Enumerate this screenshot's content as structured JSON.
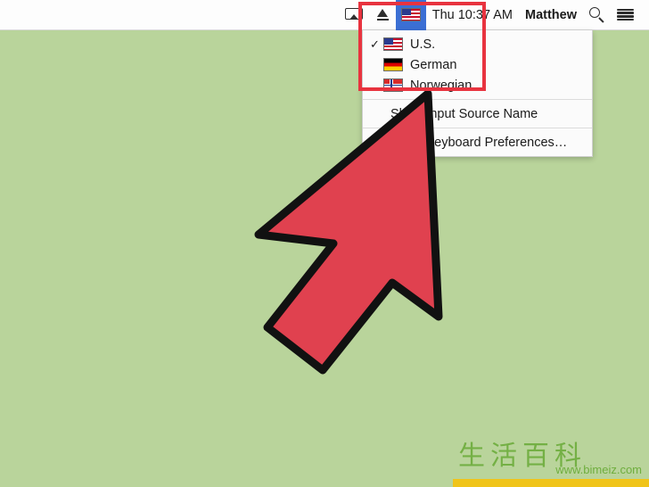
{
  "menubar": {
    "items": [
      {
        "name": "airplay-icon",
        "label": ""
      },
      {
        "name": "eject-icon",
        "label": ""
      },
      {
        "name": "input-source-flag",
        "label": ""
      }
    ],
    "clock": "Thu 10:37 AM",
    "user": "Matthew",
    "search_icon": "search-icon",
    "notification_icon": "list-icon"
  },
  "dropdown": {
    "sources": [
      {
        "label": "U.S.",
        "flag": "us",
        "checked": true,
        "check_glyph": "✓"
      },
      {
        "label": "German",
        "flag": "de",
        "checked": false,
        "check_glyph": ""
      },
      {
        "label": "Norwegian",
        "flag": "no",
        "checked": false,
        "check_glyph": ""
      }
    ],
    "actions": [
      {
        "label": "Show Input Source Name"
      },
      {
        "label": "Open Keyboard Preferences…"
      }
    ]
  },
  "annotation": {
    "highlight_color": "#e8333f",
    "arrow_fill": "#e0414f",
    "arrow_stroke": "#111111"
  },
  "watermark": {
    "logo": "生活百科",
    "url": "www.bimeiz.com",
    "bar_color": "#f0c419",
    "text_color": "#6fae3e"
  }
}
